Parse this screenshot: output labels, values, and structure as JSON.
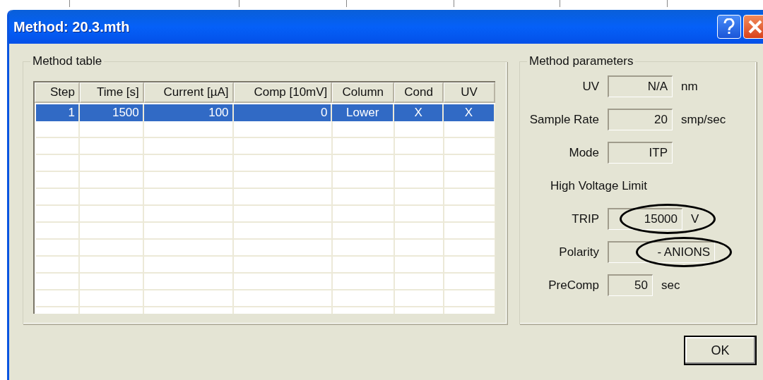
{
  "window": {
    "title": "Method: 20.3.mth"
  },
  "method_table": {
    "label": "Method table",
    "columns": [
      "Step",
      "Time [s]",
      "Current [µA]",
      "Comp [10mV]",
      "Column",
      "Cond",
      "UV"
    ],
    "rows": [
      {
        "selected": true,
        "cells": [
          "1",
          "1500",
          "100",
          "0",
          "Lower",
          "X",
          "X"
        ]
      }
    ]
  },
  "method_parameters": {
    "label": "Method parameters",
    "fields": [
      {
        "kind": "field",
        "label": "UV",
        "value": "N/A",
        "unit": "nm",
        "highlighted": false
      },
      {
        "kind": "field",
        "label": "Sample Rate",
        "value": "20",
        "unit": "smp/sec",
        "highlighted": false
      },
      {
        "kind": "field",
        "label": "Mode",
        "value": "ITP",
        "highlighted": false
      },
      {
        "kind": "heading",
        "label": "High Voltage Limit"
      },
      {
        "kind": "field",
        "label": "TRIP",
        "value": "15000",
        "unit": "V",
        "highlighted": true
      },
      {
        "kind": "field",
        "label": "Polarity",
        "value": "- ANIONS",
        "highlighted": true
      },
      {
        "kind": "field",
        "label": "PreComp",
        "value": "50",
        "unit": "sec",
        "highlighted": false
      }
    ]
  },
  "buttons": [
    "OK"
  ]
}
